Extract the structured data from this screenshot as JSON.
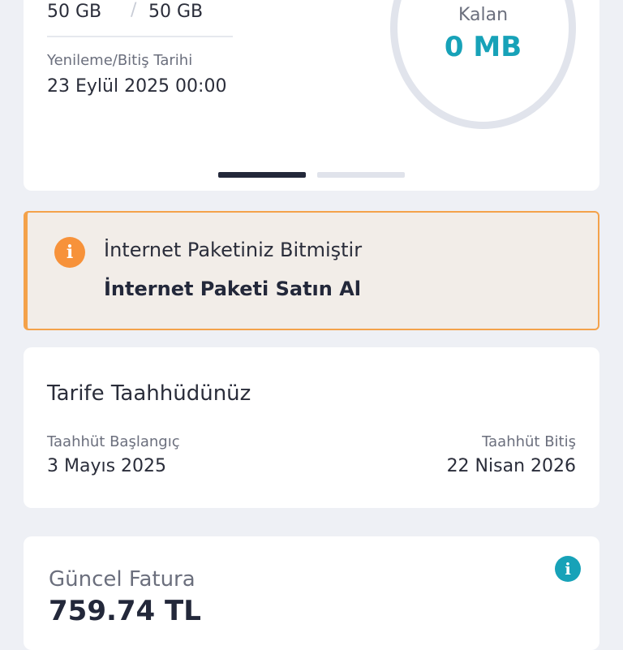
{
  "usage": {
    "used": "50 GB",
    "total": "50 GB",
    "renewal_label": "Yenileme/Bitiş Tarihi",
    "renewal_date": "23 Eylül 2025 00:00",
    "remaining_label": "Kalan",
    "remaining_value": "0 MB",
    "page_indicator": {
      "pages": 2,
      "active": 1
    }
  },
  "alert": {
    "icon": "info-icon",
    "icon_glyph": "i",
    "title": "İnternet Paketiniz Bitmiştir",
    "action": "İnternet Paketi Satın Al",
    "accent_color": "#f4a24a"
  },
  "commitment": {
    "title": "Tarife Taahhüdünüz",
    "start_label": "Taahhüt Başlangıç",
    "start_date": "3 Mayıs 2025",
    "end_label": "Taahhüt Bitiş",
    "end_date": "22 Nisan 2026"
  },
  "invoice": {
    "title": "Güncel Fatura",
    "amount": "759.74 TL",
    "info_glyph": "i"
  },
  "colors": {
    "accent_teal": "#17a2b8",
    "warning_orange": "#f7923a",
    "text_dark": "#23283a"
  }
}
